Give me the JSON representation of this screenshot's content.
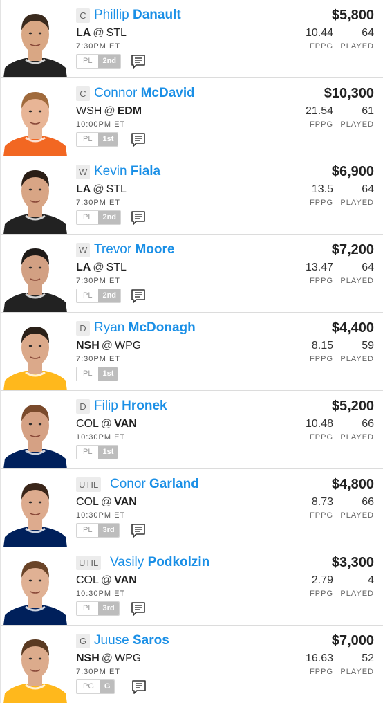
{
  "players": [
    {
      "pos": "C",
      "first": "Phillip",
      "last": "Danault",
      "home": "LA",
      "away": "STL",
      "fav": "home",
      "time": "7:30PM ET",
      "tag_key": "PL",
      "tag_val": "2nd",
      "has_note": true,
      "salary": "$5,800",
      "fppg": "10.44",
      "played": "64",
      "fppg_label": "FPPG",
      "played_label": "PLAYED",
      "jersey": "#222222",
      "skin": "#d9a784",
      "hair": "#3a2a1e"
    },
    {
      "pos": "C",
      "first": "Connor",
      "last": "McDavid",
      "home": "WSH",
      "away": "EDM",
      "fav": "away",
      "time": "10:00PM ET",
      "tag_key": "PL",
      "tag_val": "1st",
      "has_note": true,
      "salary": "$10,300",
      "fppg": "21.54",
      "played": "61",
      "fppg_label": "FPPG",
      "played_label": "PLAYED",
      "jersey": "#f26722",
      "skin": "#e8b596",
      "hair": "#a06a3c"
    },
    {
      "pos": "W",
      "first": "Kevin",
      "last": "Fiala",
      "home": "LA",
      "away": "STL",
      "fav": "home",
      "time": "7:30PM ET",
      "tag_key": "PL",
      "tag_val": "2nd",
      "has_note": true,
      "salary": "$6,900",
      "fppg": "13.5",
      "played": "64",
      "fppg_label": "FPPG",
      "played_label": "PLAYED",
      "jersey": "#222222",
      "skin": "#d8a585",
      "hair": "#2a1e16"
    },
    {
      "pos": "W",
      "first": "Trevor",
      "last": "Moore",
      "home": "LA",
      "away": "STL",
      "fav": "home",
      "time": "7:30PM ET",
      "tag_key": "PL",
      "tag_val": "2nd",
      "has_note": true,
      "salary": "$7,200",
      "fppg": "13.47",
      "played": "64",
      "fppg_label": "FPPG",
      "played_label": "PLAYED",
      "jersey": "#222222",
      "skin": "#d2a083",
      "hair": "#1e1a18"
    },
    {
      "pos": "D",
      "first": "Ryan",
      "last": "McDonagh",
      "home": "NSH",
      "away": "WPG",
      "fav": "home",
      "time": "7:30PM ET",
      "tag_key": "PL",
      "tag_val": "1st",
      "has_note": false,
      "salary": "$4,400",
      "fppg": "8.15",
      "played": "59",
      "fppg_label": "FPPG",
      "played_label": "PLAYED",
      "jersey": "#ffb81c",
      "skin": "#dba98a",
      "hair": "#2a2018"
    },
    {
      "pos": "D",
      "first": "Filip",
      "last": "Hronek",
      "home": "COL",
      "away": "VAN",
      "fav": "away",
      "time": "10:30PM ET",
      "tag_key": "PL",
      "tag_val": "1st",
      "has_note": false,
      "salary": "$5,200",
      "fppg": "10.48",
      "played": "66",
      "fppg_label": "FPPG",
      "played_label": "PLAYED",
      "jersey": "#00205b",
      "skin": "#d5a184",
      "hair": "#7a4a2c"
    },
    {
      "pos": "UTIL",
      "first": "Conor",
      "last": "Garland",
      "home": "COL",
      "away": "VAN",
      "fav": "away",
      "time": "10:30PM ET",
      "tag_key": "PL",
      "tag_val": "3rd",
      "has_note": true,
      "salary": "$4,800",
      "fppg": "8.73",
      "played": "66",
      "fppg_label": "FPPG",
      "played_label": "PLAYED",
      "jersey": "#00205b",
      "skin": "#ddab8e",
      "hair": "#3a261a"
    },
    {
      "pos": "UTIL",
      "first": "Vasily",
      "last": "Podkolzin",
      "home": "COL",
      "away": "VAN",
      "fav": "away",
      "time": "10:30PM ET",
      "tag_key": "PL",
      "tag_val": "3rd",
      "has_note": true,
      "salary": "$3,300",
      "fppg": "2.79",
      "played": "4",
      "fppg_label": "FPPG",
      "played_label": "PLAYED",
      "jersey": "#00205b",
      "skin": "#e0b194",
      "hair": "#6a4428"
    },
    {
      "pos": "G",
      "first": "Juuse",
      "last": "Saros",
      "home": "NSH",
      "away": "WPG",
      "fav": "home",
      "time": "7:30PM ET",
      "tag_key": "PG",
      "tag_val": "G",
      "has_note": true,
      "salary": "$7,000",
      "fppg": "16.63",
      "played": "52",
      "fppg_label": "FPPG",
      "played_label": "PLAYED",
      "jersey": "#ffb81c",
      "skin": "#dcab8c",
      "hair": "#5a3a22"
    }
  ],
  "icons": {
    "note": "notes-icon",
    "photo": "player-headshot"
  },
  "colors": {
    "accent": "#1a8fe6",
    "tag_fill": "#bdbdbd"
  }
}
